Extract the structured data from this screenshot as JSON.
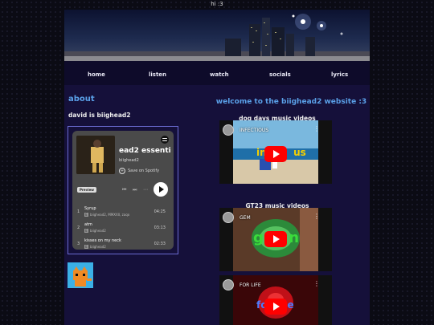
{
  "window": {
    "title": "hi :3"
  },
  "nav": {
    "items": [
      "home",
      "listen",
      "watch",
      "socials",
      "lyrics"
    ]
  },
  "left": {
    "heading": "about",
    "about_text": "david is biighead2"
  },
  "spotify": {
    "title": "ead2 essenti",
    "artist": "biighead2",
    "save_label": "Save on Spotify",
    "preview_label": "Preview",
    "tracks": [
      {
        "num": "1",
        "title": "Syrup",
        "artist": "biighead2, MMXXII, zaqo",
        "duration": "04:25"
      },
      {
        "num": "2",
        "title": "atm",
        "artist": "biighead2",
        "duration": "03:13"
      },
      {
        "num": "3",
        "title": "kisses on my neck",
        "artist": "biighead2",
        "duration": "02:33"
      }
    ]
  },
  "right": {
    "heading": "welcome to the biighead2 website :3",
    "section1": "dog days music videos",
    "section2": "GT23 music videos"
  },
  "videos": [
    {
      "title": "INFECTIOUS",
      "overlay": "in        us"
    },
    {
      "title": "GEM",
      "overlay": "g     n"
    },
    {
      "title": "FOR LIFE",
      "overlay": "fo      e"
    }
  ],
  "colors": {
    "accent": "#5aa0e8",
    "page_bg": "#15103a",
    "youtube_red": "#ff0000"
  }
}
